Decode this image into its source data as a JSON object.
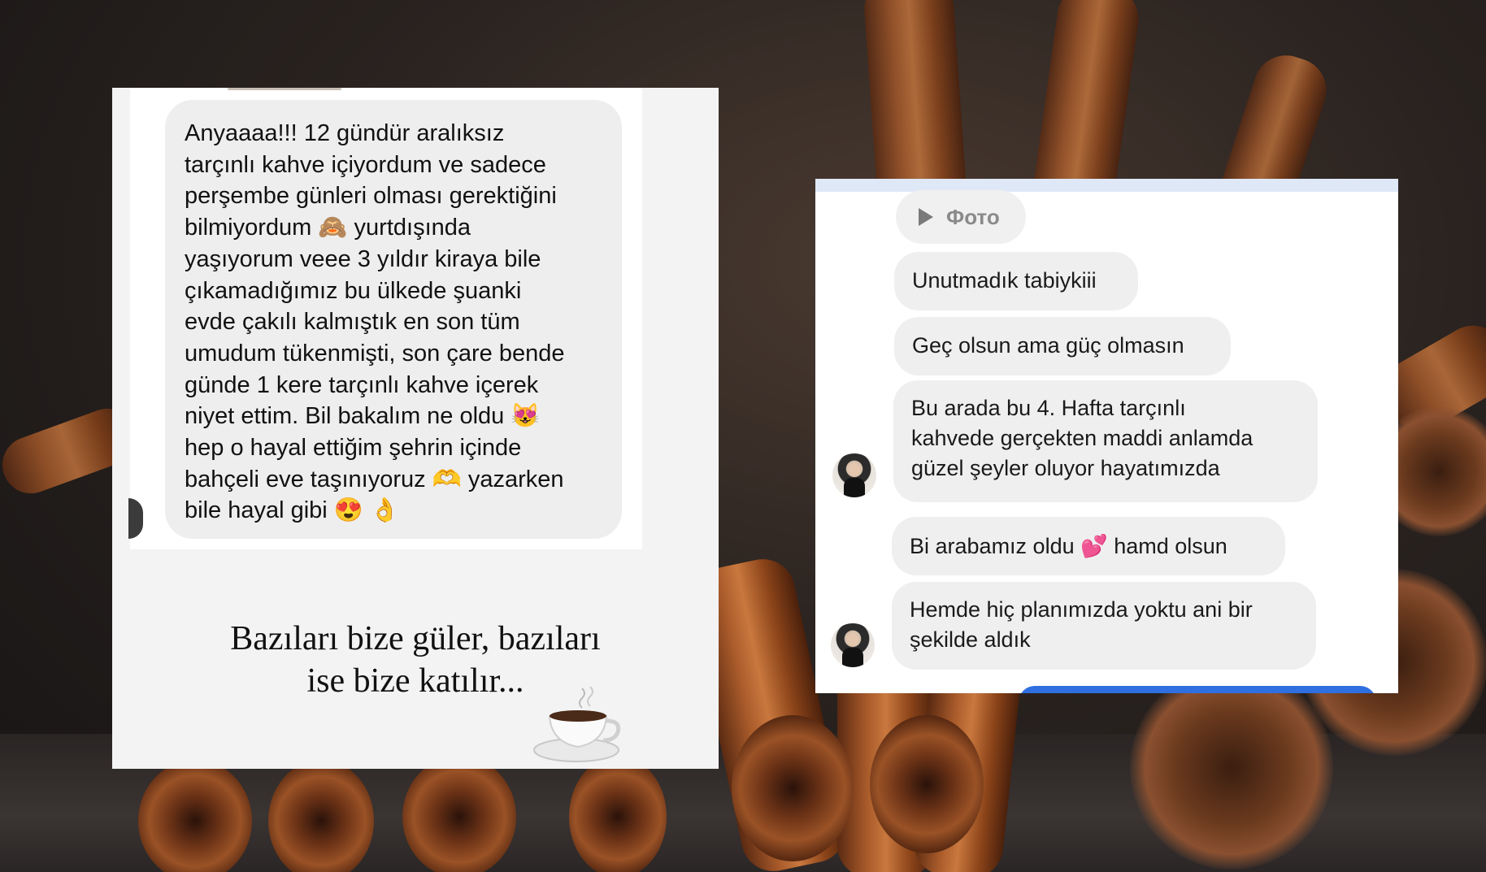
{
  "left_message": {
    "lines": [
      "Anyaaaa!!! 12 gündür aralıksız",
      "tarçınlı kahve içiyordum ve sadece",
      "perşembe günleri olması gerektiğini",
      "bilmiyordum 🙈 yurtdışında",
      "yaşıyorum veee 3 yıldır kiraya bile",
      "çıkamadığımız bu ülkede şuanki",
      "evde çakılı kalmıştık en son tüm",
      "umudum tükenmişti, son çare bende",
      "günde 1 kere tarçınlı kahve içerek",
      "niyet ettim. Bil bakalım ne oldu 😻",
      "hep o hayal ettiğim şehrin içinde",
      "bahçeli eve taşınıyoruz 🫶 yazarken",
      "bile hayal gibi 😍 👌"
    ]
  },
  "quote": {
    "line1": "Bazıları bize güler, bazıları",
    "line2": "ise bize katılır..."
  },
  "icons": {
    "cup": "coffee-cup-icon",
    "play": "play-icon",
    "avatar": "avatar"
  },
  "right_chat": {
    "photo_label": "Фото",
    "messages": [
      {
        "lines": [
          "Unutmadık tabiykiii"
        ]
      },
      {
        "lines": [
          "Geç olsun ama güç olmasın"
        ]
      },
      {
        "lines": [
          "Bu arada bu 4. Hafta tarçınlı",
          "kahvede gerçekten maddi anlamda",
          "güzel şeyler oluyor hayatımızda"
        ]
      },
      {
        "lines": [
          "Bi arabamız oldu 💕 hamd olsun"
        ]
      },
      {
        "lines": [
          "Hemde hiç planımızda yoktu ani bir",
          "şekilde aldık"
        ]
      }
    ]
  },
  "colors": {
    "bubble": "#efefef",
    "accent_blue": "#2f6fe0",
    "panel_top_bar": "#dfe8f7"
  }
}
